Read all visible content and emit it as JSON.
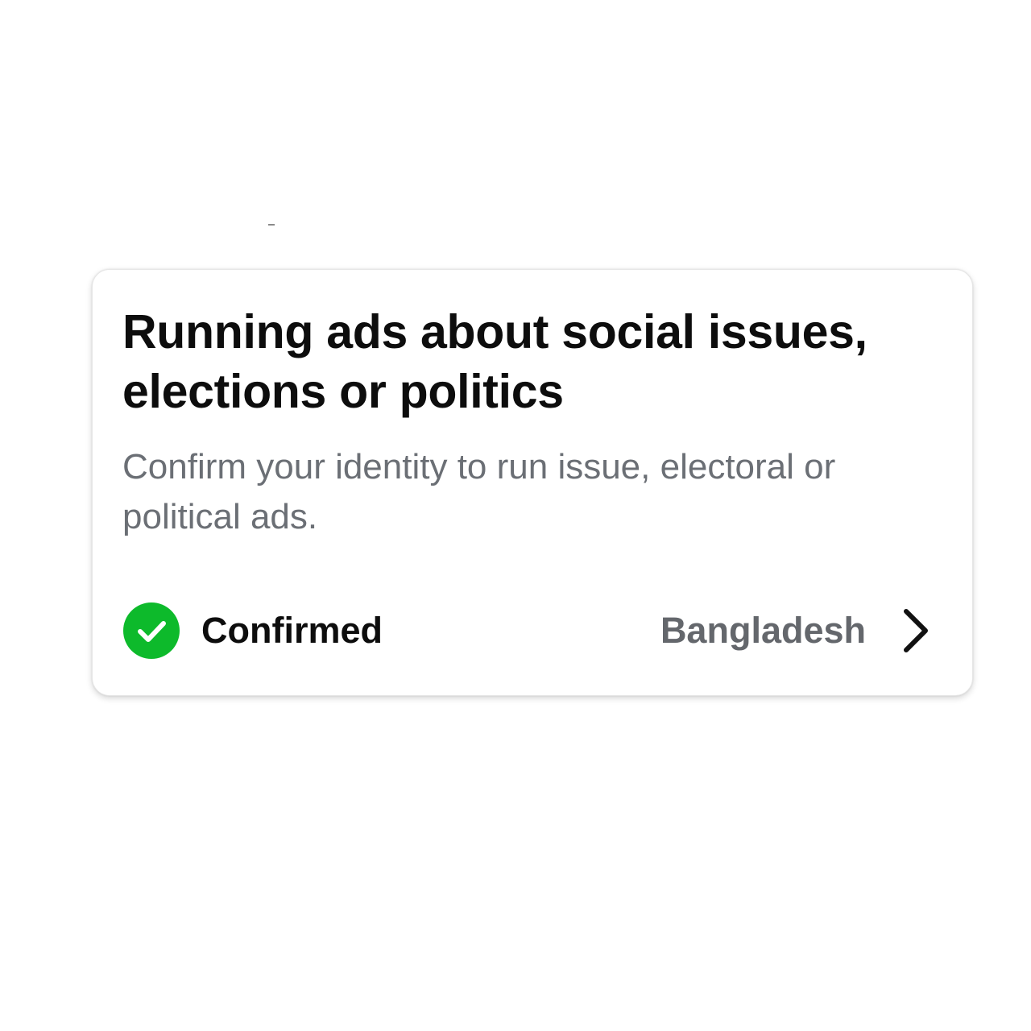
{
  "card": {
    "title": "Running ads about social issues, elections or politics",
    "description": "Confirm your identity to run issue, electoral or political ads.",
    "status": {
      "icon": "check-circle-icon",
      "icon_color": "#0dba2b",
      "label": "Confirmed"
    },
    "country": {
      "label": "Bangladesh",
      "icon": "chevron-right-icon"
    }
  }
}
